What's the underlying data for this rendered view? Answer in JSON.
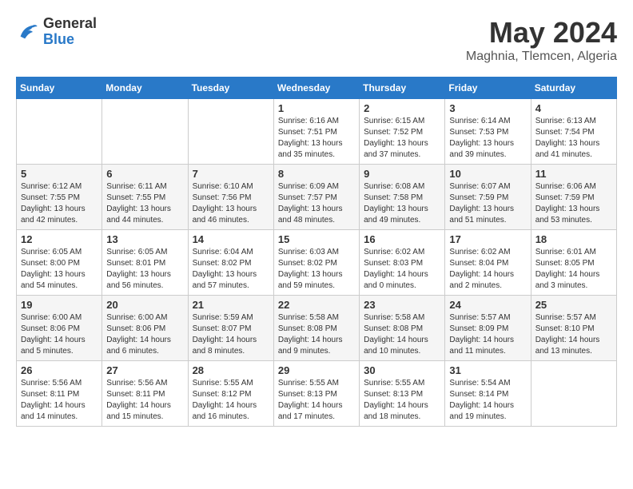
{
  "logo": {
    "general": "General",
    "blue": "Blue"
  },
  "header": {
    "month": "May 2024",
    "location": "Maghnia, Tlemcen, Algeria"
  },
  "weekdays": [
    "Sunday",
    "Monday",
    "Tuesday",
    "Wednesday",
    "Thursday",
    "Friday",
    "Saturday"
  ],
  "weeks": [
    [
      {
        "day": "",
        "info": ""
      },
      {
        "day": "",
        "info": ""
      },
      {
        "day": "",
        "info": ""
      },
      {
        "day": "1",
        "info": "Sunrise: 6:16 AM\nSunset: 7:51 PM\nDaylight: 13 hours\nand 35 minutes."
      },
      {
        "day": "2",
        "info": "Sunrise: 6:15 AM\nSunset: 7:52 PM\nDaylight: 13 hours\nand 37 minutes."
      },
      {
        "day": "3",
        "info": "Sunrise: 6:14 AM\nSunset: 7:53 PM\nDaylight: 13 hours\nand 39 minutes."
      },
      {
        "day": "4",
        "info": "Sunrise: 6:13 AM\nSunset: 7:54 PM\nDaylight: 13 hours\nand 41 minutes."
      }
    ],
    [
      {
        "day": "5",
        "info": "Sunrise: 6:12 AM\nSunset: 7:55 PM\nDaylight: 13 hours\nand 42 minutes."
      },
      {
        "day": "6",
        "info": "Sunrise: 6:11 AM\nSunset: 7:55 PM\nDaylight: 13 hours\nand 44 minutes."
      },
      {
        "day": "7",
        "info": "Sunrise: 6:10 AM\nSunset: 7:56 PM\nDaylight: 13 hours\nand 46 minutes."
      },
      {
        "day": "8",
        "info": "Sunrise: 6:09 AM\nSunset: 7:57 PM\nDaylight: 13 hours\nand 48 minutes."
      },
      {
        "day": "9",
        "info": "Sunrise: 6:08 AM\nSunset: 7:58 PM\nDaylight: 13 hours\nand 49 minutes."
      },
      {
        "day": "10",
        "info": "Sunrise: 6:07 AM\nSunset: 7:59 PM\nDaylight: 13 hours\nand 51 minutes."
      },
      {
        "day": "11",
        "info": "Sunrise: 6:06 AM\nSunset: 7:59 PM\nDaylight: 13 hours\nand 53 minutes."
      }
    ],
    [
      {
        "day": "12",
        "info": "Sunrise: 6:05 AM\nSunset: 8:00 PM\nDaylight: 13 hours\nand 54 minutes."
      },
      {
        "day": "13",
        "info": "Sunrise: 6:05 AM\nSunset: 8:01 PM\nDaylight: 13 hours\nand 56 minutes."
      },
      {
        "day": "14",
        "info": "Sunrise: 6:04 AM\nSunset: 8:02 PM\nDaylight: 13 hours\nand 57 minutes."
      },
      {
        "day": "15",
        "info": "Sunrise: 6:03 AM\nSunset: 8:02 PM\nDaylight: 13 hours\nand 59 minutes."
      },
      {
        "day": "16",
        "info": "Sunrise: 6:02 AM\nSunset: 8:03 PM\nDaylight: 14 hours\nand 0 minutes."
      },
      {
        "day": "17",
        "info": "Sunrise: 6:02 AM\nSunset: 8:04 PM\nDaylight: 14 hours\nand 2 minutes."
      },
      {
        "day": "18",
        "info": "Sunrise: 6:01 AM\nSunset: 8:05 PM\nDaylight: 14 hours\nand 3 minutes."
      }
    ],
    [
      {
        "day": "19",
        "info": "Sunrise: 6:00 AM\nSunset: 8:06 PM\nDaylight: 14 hours\nand 5 minutes."
      },
      {
        "day": "20",
        "info": "Sunrise: 6:00 AM\nSunset: 8:06 PM\nDaylight: 14 hours\nand 6 minutes."
      },
      {
        "day": "21",
        "info": "Sunrise: 5:59 AM\nSunset: 8:07 PM\nDaylight: 14 hours\nand 8 minutes."
      },
      {
        "day": "22",
        "info": "Sunrise: 5:58 AM\nSunset: 8:08 PM\nDaylight: 14 hours\nand 9 minutes."
      },
      {
        "day": "23",
        "info": "Sunrise: 5:58 AM\nSunset: 8:08 PM\nDaylight: 14 hours\nand 10 minutes."
      },
      {
        "day": "24",
        "info": "Sunrise: 5:57 AM\nSunset: 8:09 PM\nDaylight: 14 hours\nand 11 minutes."
      },
      {
        "day": "25",
        "info": "Sunrise: 5:57 AM\nSunset: 8:10 PM\nDaylight: 14 hours\nand 13 minutes."
      }
    ],
    [
      {
        "day": "26",
        "info": "Sunrise: 5:56 AM\nSunset: 8:11 PM\nDaylight: 14 hours\nand 14 minutes."
      },
      {
        "day": "27",
        "info": "Sunrise: 5:56 AM\nSunset: 8:11 PM\nDaylight: 14 hours\nand 15 minutes."
      },
      {
        "day": "28",
        "info": "Sunrise: 5:55 AM\nSunset: 8:12 PM\nDaylight: 14 hours\nand 16 minutes."
      },
      {
        "day": "29",
        "info": "Sunrise: 5:55 AM\nSunset: 8:13 PM\nDaylight: 14 hours\nand 17 minutes."
      },
      {
        "day": "30",
        "info": "Sunrise: 5:55 AM\nSunset: 8:13 PM\nDaylight: 14 hours\nand 18 minutes."
      },
      {
        "day": "31",
        "info": "Sunrise: 5:54 AM\nSunset: 8:14 PM\nDaylight: 14 hours\nand 19 minutes."
      },
      {
        "day": "",
        "info": ""
      }
    ]
  ]
}
